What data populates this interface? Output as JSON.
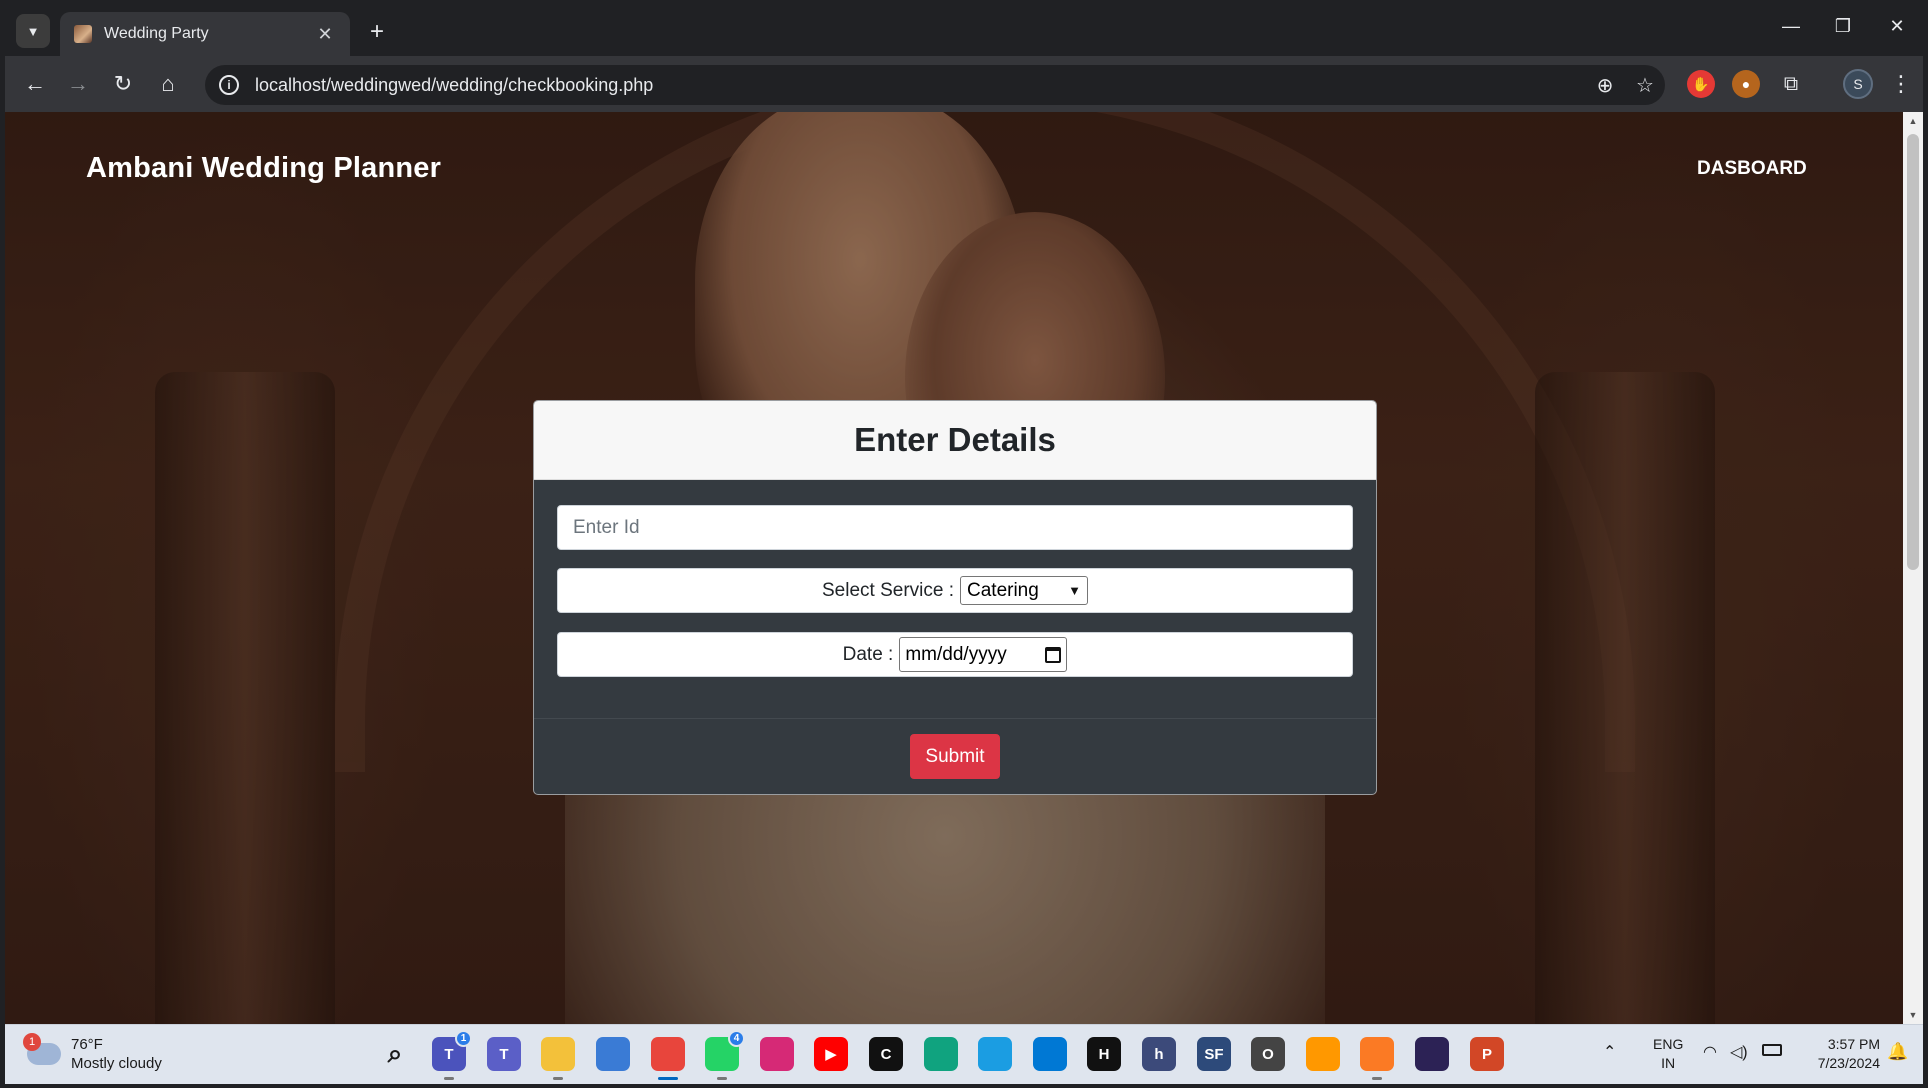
{
  "browser": {
    "tab_title": "Wedding Party",
    "tab_close": "✕",
    "new_tab": "+",
    "url": "localhost/weddingwed/wedding/checkbooking.php",
    "window_controls": {
      "minimize": "—",
      "restore": "❐",
      "close": "✕"
    },
    "nav": {
      "back": "←",
      "forward": "→",
      "reload": "↻",
      "home": "⌂"
    },
    "omnibox_icons": {
      "zoom": "⊕",
      "bookmark": "☆"
    },
    "profile_initial": "S",
    "menu": "⋮"
  },
  "page": {
    "brand": "Ambani Wedding Planner",
    "nav_link": "DASBOARD",
    "form": {
      "title": "Enter Details",
      "id_placeholder": "Enter Id",
      "service_label": "Select Service :",
      "service_selected": "Catering",
      "date_label": "Date :",
      "date_placeholder": "mm/dd/yyyy",
      "submit_label": "Submit"
    }
  },
  "taskbar": {
    "weather": {
      "temp": "76°F",
      "condition": "Mostly cloudy",
      "badge": "1"
    },
    "apps": [
      {
        "name": "windows-start",
        "label": "",
        "color": "#0078d4"
      },
      {
        "name": "search",
        "label": "",
        "color": "#dfe5ee"
      },
      {
        "name": "teams-personal",
        "label": "T",
        "color": "#4b53bc",
        "badge": "1"
      },
      {
        "name": "teams",
        "label": "T",
        "color": "#5b5fc7"
      },
      {
        "name": "file-explorer",
        "label": "",
        "color": "#f3c13a"
      },
      {
        "name": "microsoft-store",
        "label": "",
        "color": "#3a7bd5"
      },
      {
        "name": "chrome",
        "label": "",
        "color": "#e8453c",
        "active": true
      },
      {
        "name": "whatsapp",
        "label": "",
        "color": "#25d366",
        "badge": "4"
      },
      {
        "name": "instagram",
        "label": "",
        "color": "#d62976"
      },
      {
        "name": "youtube",
        "label": "▶",
        "color": "#ff0000"
      },
      {
        "name": "c-app",
        "label": "C",
        "color": "#111111"
      },
      {
        "name": "chatgpt",
        "label": "",
        "color": "#10a37f"
      },
      {
        "name": "edge",
        "label": "",
        "color": "#1b9de2"
      },
      {
        "name": "vscode",
        "label": "",
        "color": "#0078d4"
      },
      {
        "name": "hackerrank",
        "label": "H",
        "color": "#111111"
      },
      {
        "name": "h-app",
        "label": "h",
        "color": "#3c4a7a"
      },
      {
        "name": "sf-app",
        "label": "SF",
        "color": "#2d4a7a"
      },
      {
        "name": "o-app",
        "label": "O",
        "color": "#444444"
      },
      {
        "name": "sublime",
        "label": "",
        "color": "#ff9800"
      },
      {
        "name": "xampp",
        "label": "",
        "color": "#fb7a24"
      },
      {
        "name": "eclipse",
        "label": "",
        "color": "#2c2255"
      },
      {
        "name": "powerpoint",
        "label": "P",
        "color": "#d24726"
      }
    ],
    "tray": {
      "language": "ENG",
      "region": "IN",
      "time": "3:57 PM",
      "date": "7/23/2024"
    }
  }
}
